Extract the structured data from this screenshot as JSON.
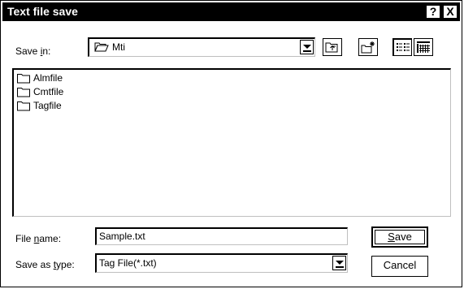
{
  "window": {
    "title": "Text file save",
    "help_label": "?",
    "close_label": "X"
  },
  "save_in": {
    "label_prefix": "Save ",
    "label_accel": "i",
    "label_suffix": "n:",
    "current_folder": "Mti"
  },
  "file_list": {
    "items": [
      {
        "name": "Almfile",
        "type": "folder"
      },
      {
        "name": "Cmtfile",
        "type": "folder"
      },
      {
        "name": "Tagfile",
        "type": "folder"
      }
    ]
  },
  "file_name": {
    "label_prefix": "File ",
    "label_accel": "n",
    "label_suffix": "ame:",
    "value": "Sample.txt"
  },
  "save_as_type": {
    "label_prefix": "Save as ",
    "label_accel": "t",
    "label_suffix": "ype:",
    "value": "Tag File(*.txt)"
  },
  "buttons": {
    "save_accel": "S",
    "save_rest": "ave",
    "cancel": "Cancel"
  },
  "toolbar_icons": [
    "up-one-level-icon",
    "create-new-folder-icon",
    "list-view-icon",
    "details-view-icon"
  ]
}
